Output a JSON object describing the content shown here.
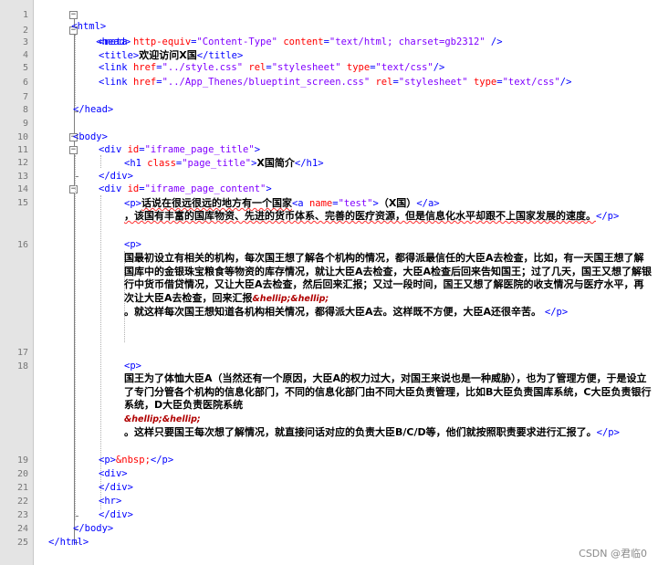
{
  "line_numbers": [
    "1",
    "2",
    "3",
    "4",
    "5",
    "6",
    "7",
    "8",
    "9",
    "10",
    "11",
    "12",
    "13",
    "14",
    "15",
    "16",
    "17",
    "18",
    "19",
    "20",
    "21",
    "22",
    "23",
    "24",
    "25"
  ],
  "code": {
    "l1": "<html>",
    "l2": "<head>",
    "l3_tag": "<meta ",
    "l3_a1": "http-equiv",
    "l3_v1": "\"Content-Type\"",
    "l3_a2": "content",
    "l3_v2": "\"text/html; charset=gb2312\"",
    "l3_end": " />",
    "l4_open": "<title>",
    "l4_text": "欢迎访问X国",
    "l4_close": "</title>",
    "l5_tag": "<link ",
    "l5_a1": "href",
    "l5_v1": "\"../style.css\"",
    "l5_a2": "rel",
    "l5_v2": "\"stylesheet\"",
    "l5_a3": "type",
    "l5_v3": "\"text/css\"",
    "l5_end": "/>",
    "l6_tag": "<link ",
    "l6_a1": "href",
    "l6_v1": "\"../App_Thenes/blueptint_screen.css\"",
    "l6_a2": "rel",
    "l6_v2": "\"stylesheet\"",
    "l6_a3": "type",
    "l6_v3": "\"text/css\"",
    "l6_end": "/>",
    "l8": "</head>",
    "l10": "<body>",
    "l11_tag": "<div ",
    "l11_a": "id",
    "l11_v": "\"iframe_page_title\"",
    "l11_end": ">",
    "l12_tag": "<h1 ",
    "l12_a": "class",
    "l12_v": "\"page_title\"",
    "l12_gt": ">",
    "l12_text": "X国简介",
    "l12_close": "</h1>",
    "l13": "</div>",
    "l14_tag": "<div ",
    "l14_a": "id",
    "l14_v": "\"iframe_page_content\"",
    "l14_end": ">",
    "l15_p": "<p>",
    "l15_text": "话说在很远很远的地方有一个国家",
    "l15_a_tag": "<a ",
    "l15_a_attr": "name",
    "l15_a_val": "\"test\"",
    "l15_a_gt": ">",
    "l15_a_text": "（X国）",
    "l15_a_close": "</a>",
    "l15_cont": "，该国有丰富的国库物资、先进的货币体系、完善的医疗资源，但是信息化水平却跟不上国家发展的速度。",
    "l15_pclose": "</p>",
    "l16_p": "<p>",
    "l16_text": "国最初设立有相关的机构，每次国王想了解各个机构的情况，都得派最信任的大臣A去检查，比如，有一天国王想了解国库中的金银珠宝粮食等物资的库存情况，就让大臣A去检查，大臣A检查后回来告知国王；过了几天，国王又想了解银行中货币借贷情况，又让大臣A去检查，然后回来汇报；又过一段时间，国王又想了解医院的收支情况与医疗水平，再次让大臣A去检查，回来汇报",
    "l16_ent": "&hellip;&hellip;",
    "l16_tail": "。就这样每次国王想知道各机构相关情况，都得派大臣A去。这样既不方便，大臣A还很辛苦。",
    "l16_pclose": "</p>",
    "l18_p": "<p>",
    "l18_text": "国王为了体恤大臣A（当然还有一个原因，大臣A的权力过大，对国王来说也是一种威胁），也为了管理方便，于是设立了专门分管各个机构的信息化部门，不同的信息化部门由不同大臣负责管理，比如B大臣负责国库系统，C大臣负责银行系统，D大臣负责医院系统",
    "l18_ent": "&hellip;&hellip;",
    "l18_tail": "。这样只要国王每次想了解情况，就直接问话对应的负责大臣B/C/D等，他们就按照职责要求进行汇报了。",
    "l18_pclose": "</p>",
    "l19_p": "<p>",
    "l19_ent": "&nbsp;",
    "l19_close": "</p>",
    "l20": "<div>",
    "l21": "</div>",
    "l22": "<hr>",
    "l23": "</div>",
    "l24": "</body>",
    "l25": "</html>"
  },
  "watermark": "CSDN @君临0"
}
